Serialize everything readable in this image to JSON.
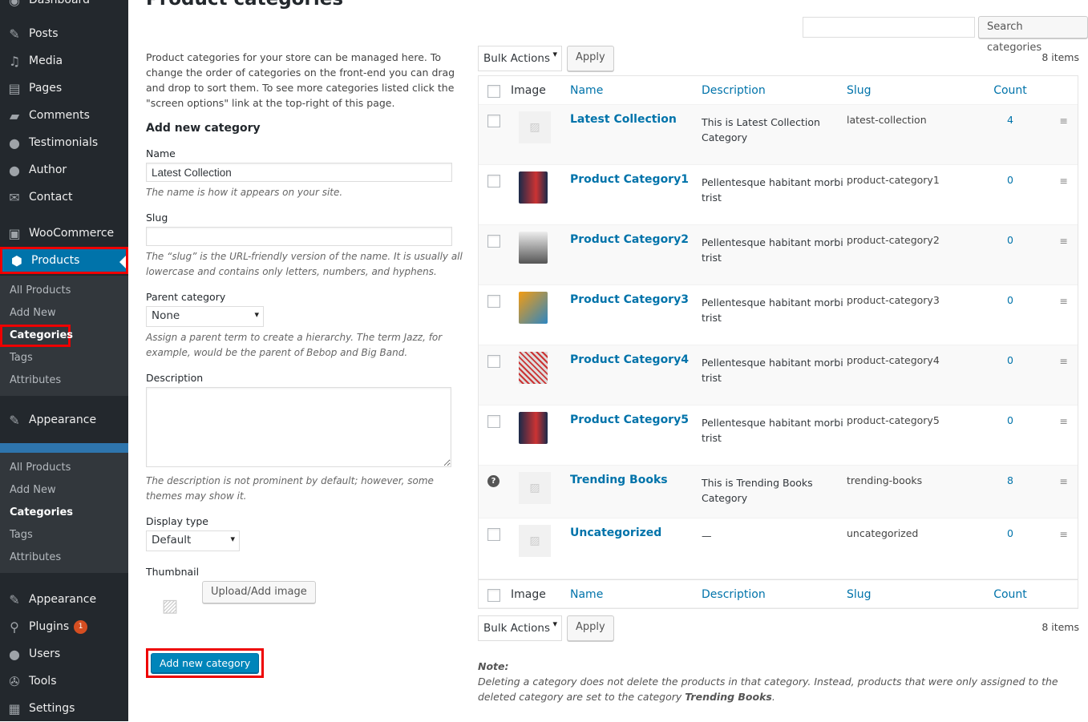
{
  "sidebar": {
    "top": [
      {
        "label": "Dashboard",
        "icon": "dashboard-icon"
      },
      {
        "label": "Posts",
        "icon": "pin-icon"
      },
      {
        "label": "Media",
        "icon": "media-icon"
      },
      {
        "label": "Pages",
        "icon": "pages-icon"
      },
      {
        "label": "Comments",
        "icon": "comment-icon"
      },
      {
        "label": "Testimonials",
        "icon": "user-icon"
      },
      {
        "label": "Author",
        "icon": "user-icon"
      },
      {
        "label": "Contact",
        "icon": "mail-icon"
      },
      {
        "label": "WooCommerce",
        "icon": "woo-icon"
      },
      {
        "label": "Products",
        "icon": "box-icon"
      }
    ],
    "sub1": [
      "All Products",
      "Add New",
      "Categories",
      "Tags",
      "Attributes"
    ],
    "appearance": "Appearance",
    "sub2": [
      "All Products",
      "Add New",
      "Categories",
      "Tags",
      "Attributes"
    ],
    "bottom": [
      {
        "label": "Appearance",
        "icon": "brush-icon"
      },
      {
        "label": "Plugins",
        "icon": "plugin-icon",
        "badge": "1"
      },
      {
        "label": "Users",
        "icon": "user-icon"
      },
      {
        "label": "Tools",
        "icon": "wrench-icon"
      },
      {
        "label": "Settings",
        "icon": "settings-icon"
      }
    ]
  },
  "page": {
    "title": "Product categories",
    "intro": "Product categories for your store can be managed here. To change the order of categories on the front-end you can drag and drop to sort them. To see more categories listed click the \"screen options\" link at the top-right of this page."
  },
  "form": {
    "heading": "Add new category",
    "name_label": "Name",
    "name_value": "Latest Collection",
    "name_help": "The name is how it appears on your site.",
    "slug_label": "Slug",
    "slug_value": "",
    "slug_help": "The “slug” is the URL-friendly version of the name. It is usually all lowercase and contains only letters, numbers, and hyphens.",
    "parent_label": "Parent category",
    "parent_value": "None",
    "parent_help": "Assign a parent term to create a hierarchy. The term Jazz, for example, would be the parent of Bebop and Big Band.",
    "desc_label": "Description",
    "desc_help": "The description is not prominent by default; however, some themes may show it.",
    "display_label": "Display type",
    "display_value": "Default",
    "thumb_label": "Thumbnail",
    "upload": "Upload/Add image",
    "submit": "Add new category"
  },
  "search": {
    "button": "Search categories",
    "value": ""
  },
  "bulk": {
    "label": "Bulk Actions",
    "apply": "Apply",
    "count": "8 items"
  },
  "columns": {
    "image": "Image",
    "name": "Name",
    "description": "Description",
    "slug": "Slug",
    "count": "Count"
  },
  "rows": [
    {
      "name": "Latest Collection",
      "description": "This is Latest Collection Category",
      "slug": "latest-collection",
      "count": "4",
      "image": "placeholder"
    },
    {
      "name": "Product Category1",
      "description": "Pellentesque habitant morbi trist",
      "slug": "product-category1",
      "count": "0",
      "image": "bitcoin-book"
    },
    {
      "name": "Product Category2",
      "description": "Pellentesque habitant morbi trist",
      "slug": "product-category2",
      "count": "0",
      "image": "wordpress-book"
    },
    {
      "name": "Product Category3",
      "description": "Pellentesque habitant morbi trist",
      "slug": "product-category3",
      "count": "0",
      "image": "blue-book"
    },
    {
      "name": "Product Category4",
      "description": "Pellentesque habitant morbi trist",
      "slug": "product-category4",
      "count": "0",
      "image": "red-book"
    },
    {
      "name": "Product Category5",
      "description": "Pellentesque habitant morbi trist",
      "slug": "product-category5",
      "count": "0",
      "image": "bitcoin-book"
    },
    {
      "name": "Trending Books",
      "description": "This is Trending Books Category",
      "slug": "trending-books",
      "count": "8",
      "image": "placeholder",
      "help": "?"
    },
    {
      "name": "Uncategorized",
      "description": "—",
      "slug": "uncategorized",
      "count": "0",
      "image": "placeholder"
    }
  ],
  "note": {
    "title": "Note:",
    "text": "Deleting a category does not delete the products in that category. Instead, products that were only assigned to the deleted category are set to the category ",
    "default": "Trending Books",
    "end": "."
  },
  "colors": {
    "sidebar": "#23282d",
    "active": "#0073aa",
    "link": "#0073aa",
    "highlight": "#ee0000"
  }
}
